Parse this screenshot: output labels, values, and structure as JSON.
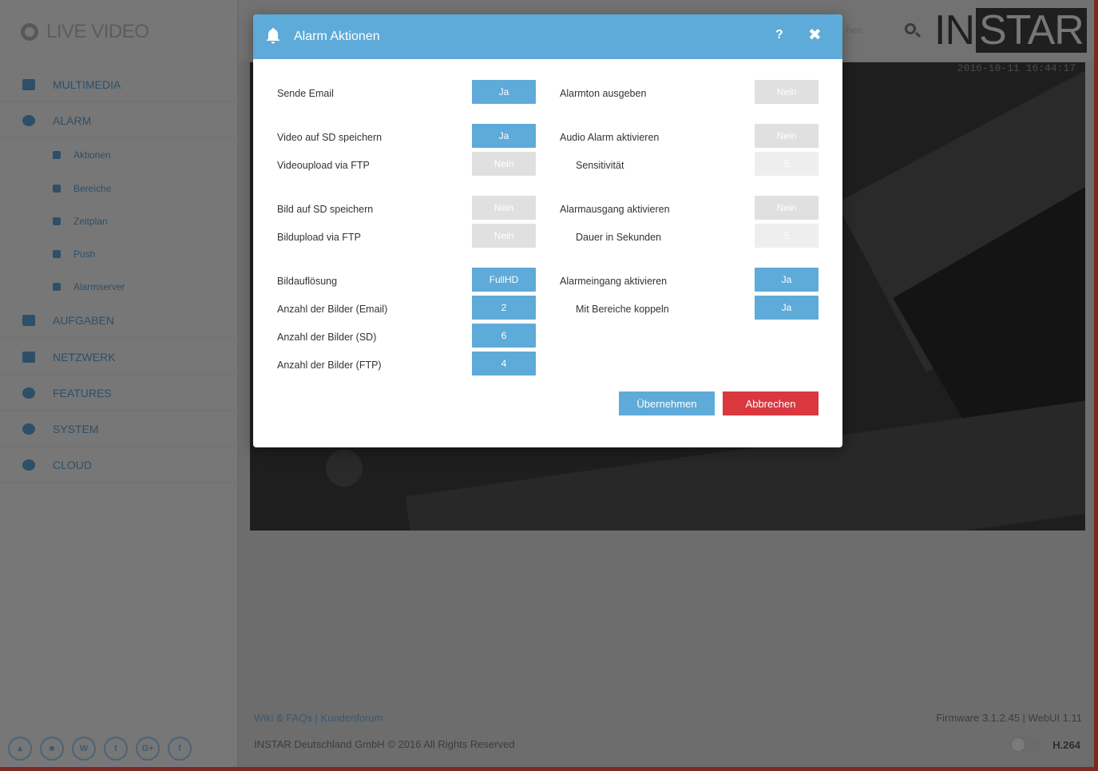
{
  "app": {
    "brand": "LIVE VIDEO",
    "logo_left": "IN",
    "logo_right": "STAR",
    "topbar_hint": "hen"
  },
  "sidebar": {
    "items": [
      {
        "label": "MULTIMEDIA"
      },
      {
        "label": "ALARM"
      },
      {
        "label": "AUFGABEN"
      },
      {
        "label": "NETZWERK"
      },
      {
        "label": "FEATURES"
      },
      {
        "label": "SYSTEM"
      },
      {
        "label": "CLOUD"
      }
    ],
    "sub_items": [
      {
        "label": "Aktionen"
      },
      {
        "label": "Bereiche"
      },
      {
        "label": "Zeitplan"
      },
      {
        "label": "Push"
      },
      {
        "label": "Alarmserver"
      }
    ],
    "social": [
      "▲",
      "■",
      "W",
      "t",
      "G+",
      "f"
    ]
  },
  "video": {
    "timestamp": "2016-10-11 16:44:17"
  },
  "footer": {
    "links": "Wiki & FAQs | Kundenforum",
    "copyright": "INSTAR Deutschland GmbH © 2016 All Rights Reserved",
    "firmware": "Firmware 3.1.2.45 | WebUI 1.11",
    "codec": "H.264"
  },
  "modal": {
    "title": "Alarm Aktionen",
    "help": "?",
    "close": "✖",
    "left": {
      "send_email": {
        "label": "Sende Email",
        "value": "Ja"
      },
      "video_sd": {
        "label": "Video auf SD speichern",
        "value": "Ja"
      },
      "video_ftp": {
        "label": "Videoupload via FTP",
        "value": "Nein"
      },
      "image_sd": {
        "label": "Bild auf SD speichern",
        "value": "Nein"
      },
      "image_ftp": {
        "label": "Bildupload via FTP",
        "value": "Nein"
      },
      "resolution": {
        "label": "Bildauflösung",
        "value": "FullHD"
      },
      "count_email": {
        "label": "Anzahl der Bilder (Email)",
        "value": "2"
      },
      "count_sd": {
        "label": "Anzahl der Bilder (SD)",
        "value": "6"
      },
      "count_ftp": {
        "label": "Anzahl der Bilder (FTP)",
        "value": "4"
      }
    },
    "right": {
      "alarm_tone": {
        "label": "Alarmton ausgeben",
        "value": "Nein"
      },
      "audio_alarm": {
        "label": "Audio Alarm aktivieren",
        "value": "Nein"
      },
      "sensitivity": {
        "label": "Sensitivität",
        "value": "5"
      },
      "alarm_output": {
        "label": "Alarmausgang aktivieren",
        "value": "Nein"
      },
      "duration": {
        "label": "Dauer in Sekunden",
        "value": "5"
      },
      "alarm_input": {
        "label": "Alarmeingang aktivieren",
        "value": "Ja"
      },
      "couple_areas": {
        "label": "Mit Bereiche koppeln",
        "value": "Ja"
      }
    },
    "apply_label": "Übernehmen",
    "cancel_label": "Abbrechen"
  }
}
